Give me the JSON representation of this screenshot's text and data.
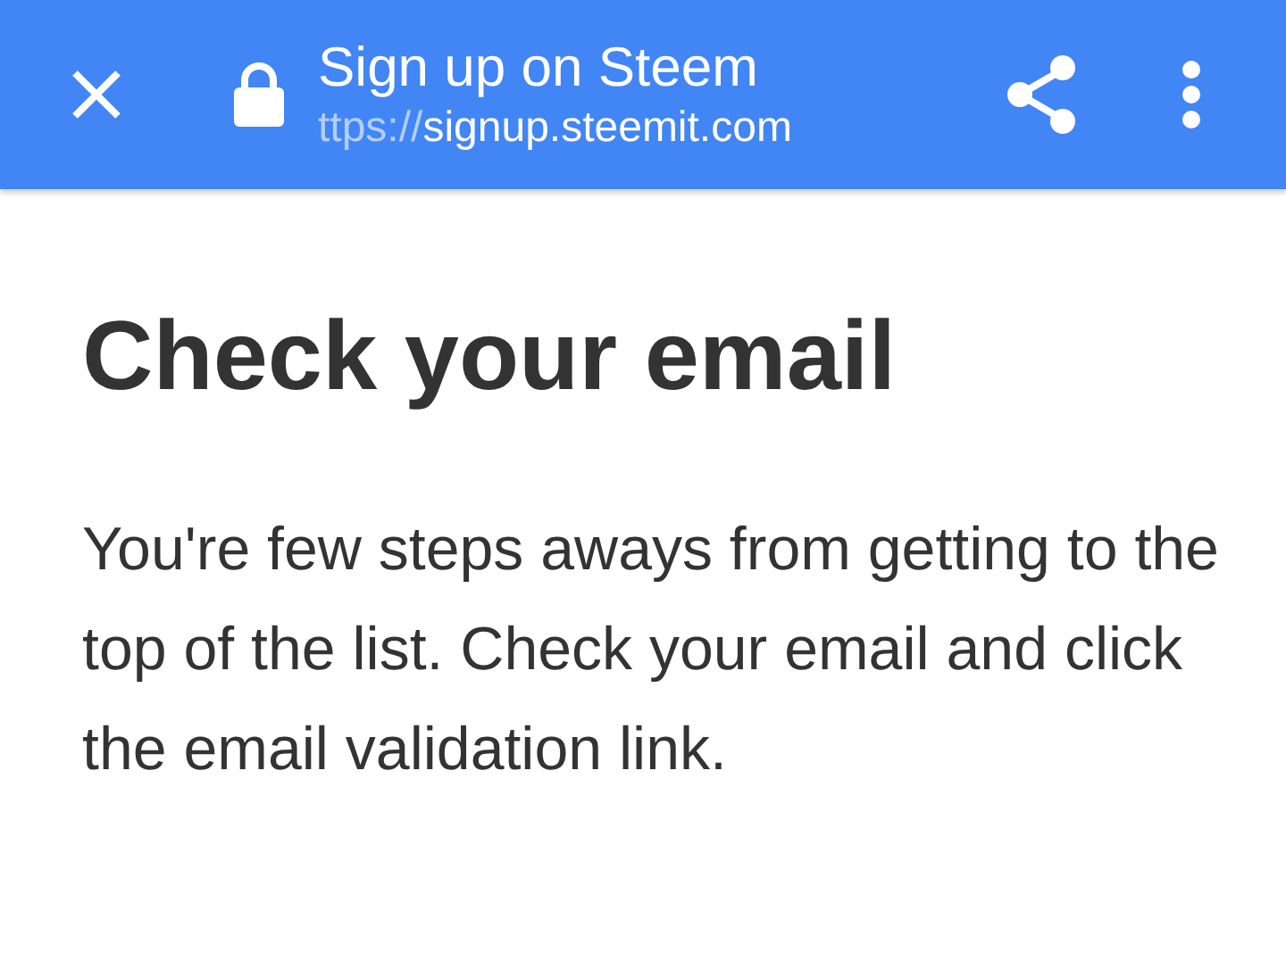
{
  "toolbar": {
    "title": "Sign up on Steem",
    "url_scheme": "ttps://",
    "url_host": "signup.steemit.com"
  },
  "page": {
    "heading": "Check your email",
    "message": "You're few steps aways from getting to the top of the list. Check your email and click the email validation link."
  }
}
